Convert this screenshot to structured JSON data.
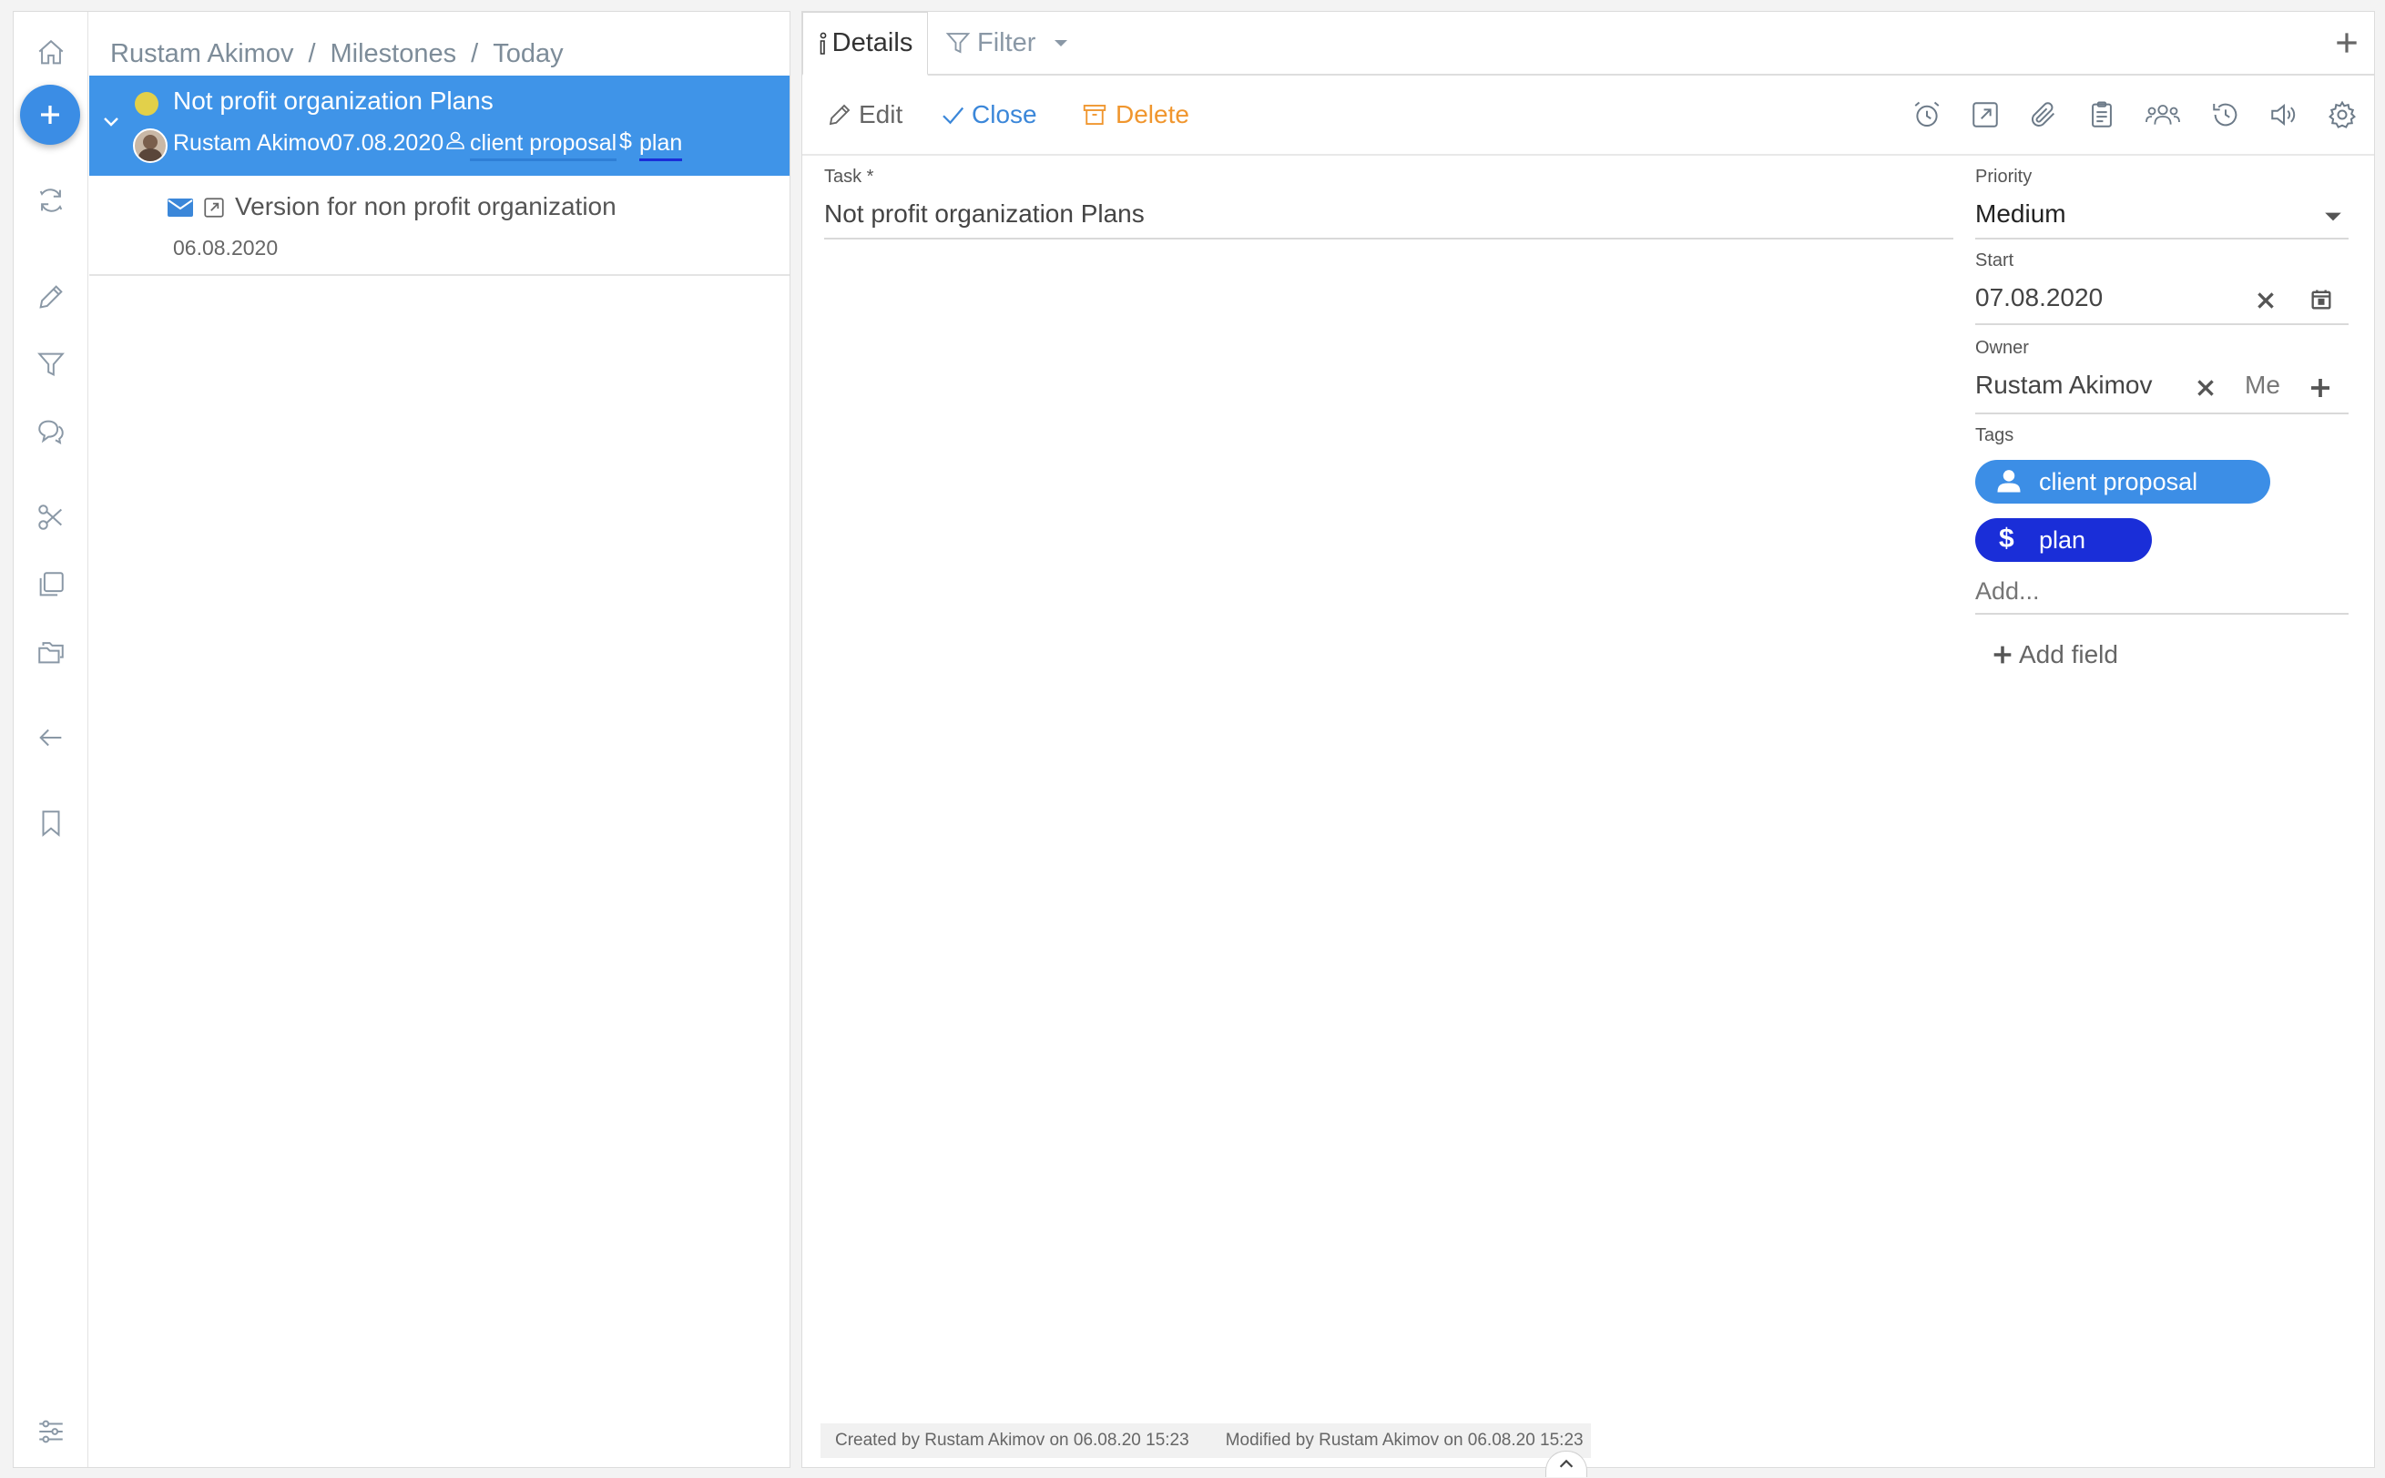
{
  "breadcrumb": {
    "items": [
      "Rustam Akimov",
      "Milestones",
      "Today"
    ],
    "separator": "/"
  },
  "sidebar": {
    "icons": [
      "home-icon",
      "refresh-icon",
      "pencil-icon",
      "filter-icon",
      "chat-icon",
      "scissors-icon",
      "copy-icon",
      "folders-icon",
      "back-arrow-icon",
      "bookmark-icon",
      "sliders-icon"
    ],
    "add_button_icon": "plus-icon"
  },
  "tasks": [
    {
      "title": "Not profit organization Plans",
      "owner": "Rustam Akimov",
      "date": "07.08.2020",
      "tags": [
        "client proposal",
        "plan"
      ],
      "status_color": "#e2d04a",
      "selected": true
    },
    {
      "title": "Version for non profit organization",
      "date": "06.08.2020",
      "icons": [
        "envelope-icon",
        "external-link-icon"
      ],
      "selected": false
    }
  ],
  "tabs": {
    "details_label": "Details",
    "filter_label": "Filter"
  },
  "toolbar": {
    "edit_label": "Edit",
    "close_label": "Close",
    "delete_label": "Delete",
    "icons": [
      "alarm-icon",
      "external-link-icon",
      "paperclip-icon",
      "clipboard-icon",
      "people-icon",
      "history-icon",
      "speaker-icon",
      "gear-icon"
    ]
  },
  "form": {
    "task_label": "Task *",
    "task_value": "Not profit organization Plans",
    "priority_label": "Priority",
    "priority_value": "Medium",
    "start_label": "Start",
    "start_value": "07.08.2020",
    "owner_label": "Owner",
    "owner_value": "Rustam Akimov",
    "owner_me_label": "Me",
    "tags_label": "Tags",
    "tags": [
      {
        "label": "client proposal",
        "icon": "person-icon",
        "color": "#3c8ee6"
      },
      {
        "label": "plan",
        "icon": "dollar-icon",
        "color": "#1a2ed8"
      }
    ],
    "tags_add_placeholder": "Add...",
    "add_field_label": "Add field"
  },
  "footer": {
    "created": "Created by Rustam Akimov on 06.08.20 15:23",
    "modified": "Modified by Rustam Akimov on 06.08.20 15:23"
  },
  "colors": {
    "accent": "#3f94e8",
    "close_blue": "#3b87d9",
    "delete_orange": "#f0962e",
    "plan_tag": "#1a2ed8",
    "client_tag": "#3c8ee6"
  }
}
